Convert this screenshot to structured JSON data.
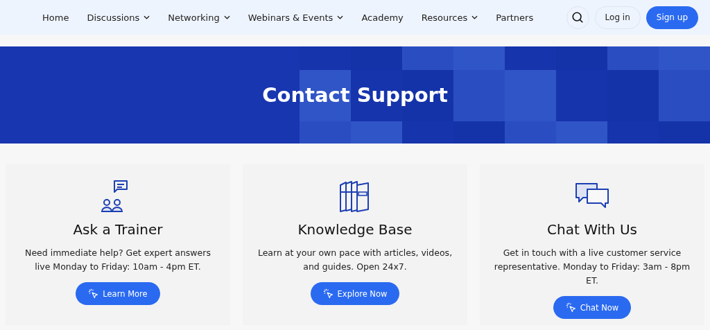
{
  "nav": {
    "items": [
      {
        "label": "Home",
        "has_menu": false
      },
      {
        "label": "Discussions",
        "has_menu": true
      },
      {
        "label": "Networking",
        "has_menu": true
      },
      {
        "label": "Webinars & Events",
        "has_menu": true
      },
      {
        "label": "Academy",
        "has_menu": false
      },
      {
        "label": "Resources",
        "has_menu": true
      },
      {
        "label": "Partners",
        "has_menu": false
      }
    ],
    "login": "Log in",
    "signup": "Sign up"
  },
  "banner": {
    "title": "Contact Support"
  },
  "cards": [
    {
      "kind": "trainer",
      "title": "Ask a Trainer",
      "text": "Need immediate help? Get expert answers live Monday to Friday: 10am - 4pm ET.",
      "button": "Learn More"
    },
    {
      "kind": "books",
      "title": "Knowledge Base",
      "text": "Learn at your own pace with articles, videos, and guides. Open 24x7.",
      "button": "Explore Now"
    },
    {
      "kind": "chat",
      "title": "Chat With Us",
      "text": "Get in touch with a live customer service representative. Monday to Friday: 3am - 8pm ET.",
      "button": "Chat Now"
    }
  ]
}
